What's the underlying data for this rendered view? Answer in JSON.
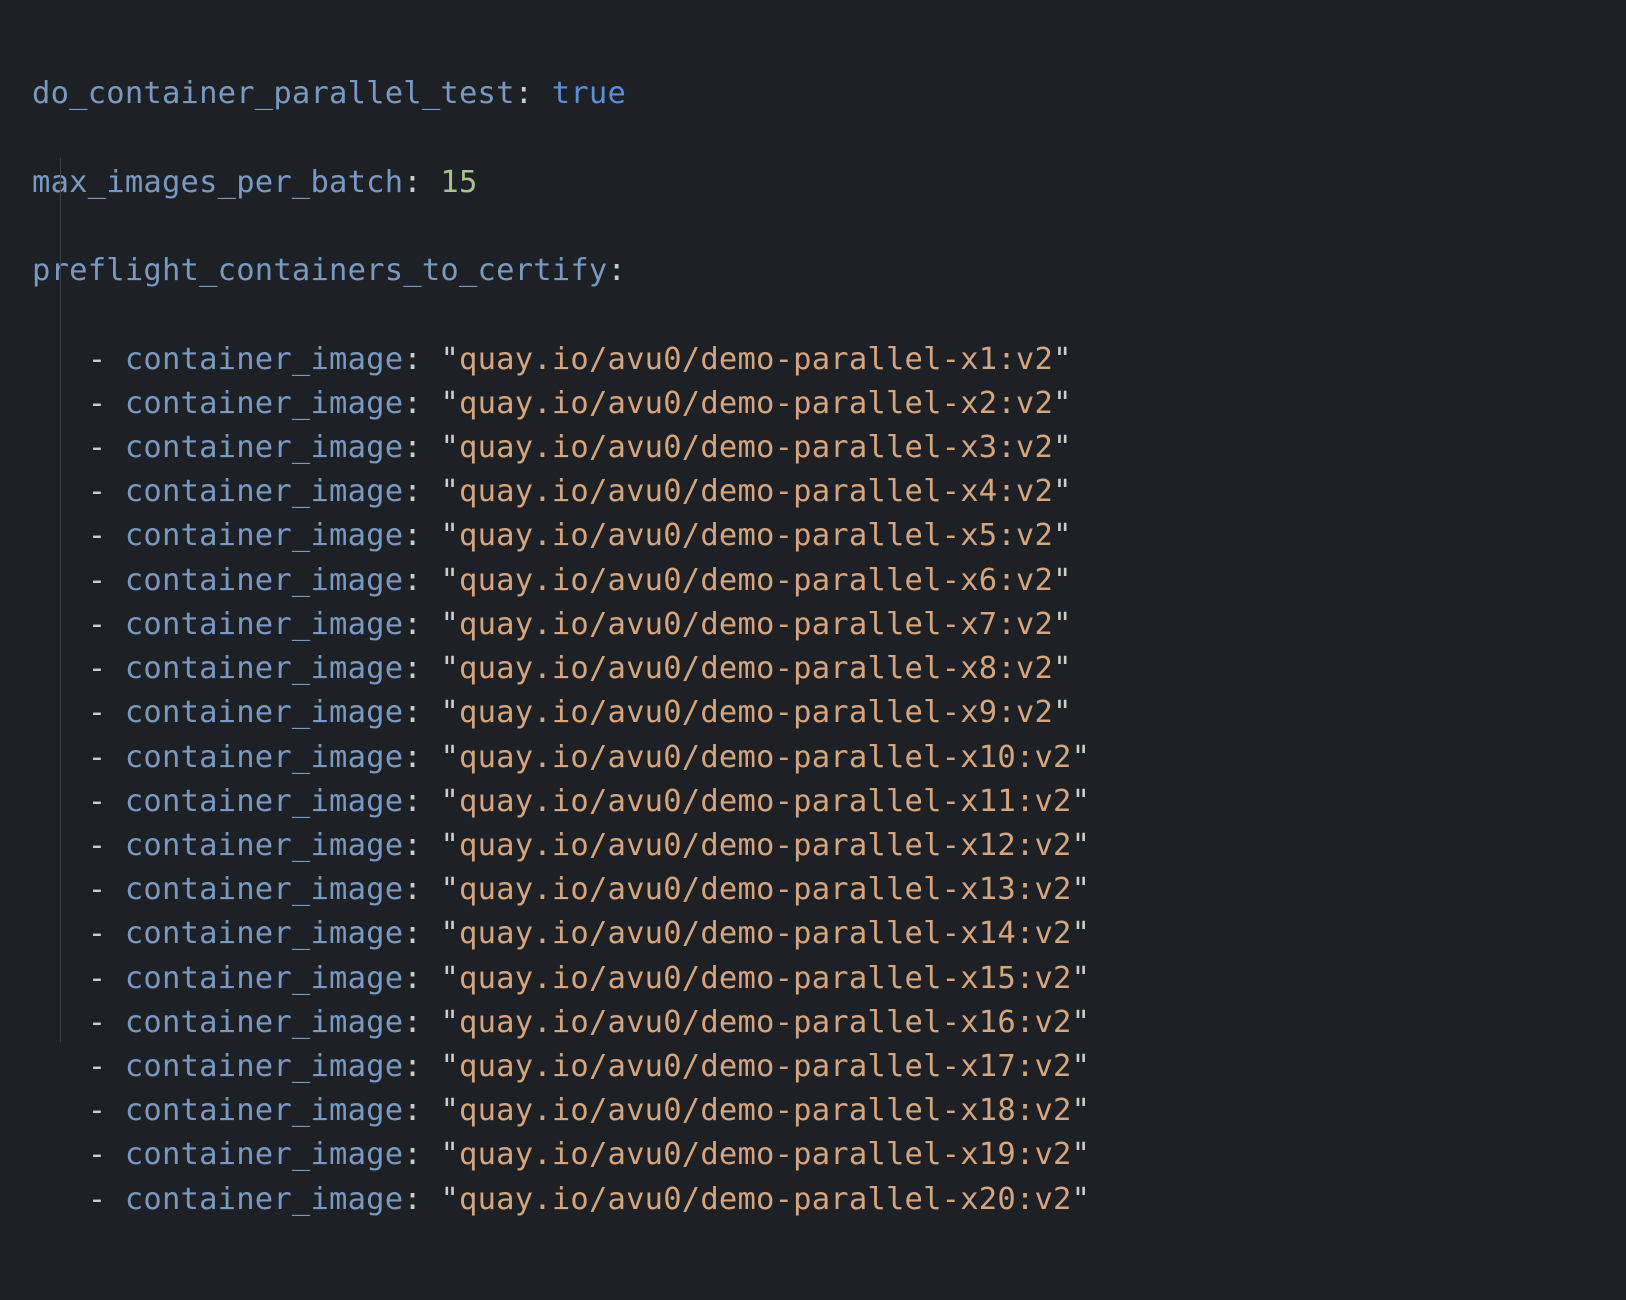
{
  "colors": {
    "background": "#1d2125",
    "key": "#7a99c2",
    "bool": "#5a8ed6",
    "number": "#a9c28a",
    "string": "#d6a57c",
    "punct": "#cccccc"
  },
  "yaml": {
    "do_container_parallel_test_key": "do_container_parallel_test",
    "do_container_parallel_test_value": "true",
    "max_images_per_batch_key": "max_images_per_batch",
    "max_images_per_batch_value": "15",
    "preflight_containers_to_certify_key": "preflight_containers_to_certify",
    "item_key": "container_image",
    "items": [
      "quay.io/avu0/demo-parallel-x1:v2",
      "quay.io/avu0/demo-parallel-x2:v2",
      "quay.io/avu0/demo-parallel-x3:v2",
      "quay.io/avu0/demo-parallel-x4:v2",
      "quay.io/avu0/demo-parallel-x5:v2",
      "quay.io/avu0/demo-parallel-x6:v2",
      "quay.io/avu0/demo-parallel-x7:v2",
      "quay.io/avu0/demo-parallel-x8:v2",
      "quay.io/avu0/demo-parallel-x9:v2",
      "quay.io/avu0/demo-parallel-x10:v2",
      "quay.io/avu0/demo-parallel-x11:v2",
      "quay.io/avu0/demo-parallel-x12:v2",
      "quay.io/avu0/demo-parallel-x13:v2",
      "quay.io/avu0/demo-parallel-x14:v2",
      "quay.io/avu0/demo-parallel-x15:v2",
      "quay.io/avu0/demo-parallel-x16:v2",
      "quay.io/avu0/demo-parallel-x17:v2",
      "quay.io/avu0/demo-parallel-x18:v2",
      "quay.io/avu0/demo-parallel-x19:v2",
      "quay.io/avu0/demo-parallel-x20:v2"
    ]
  }
}
